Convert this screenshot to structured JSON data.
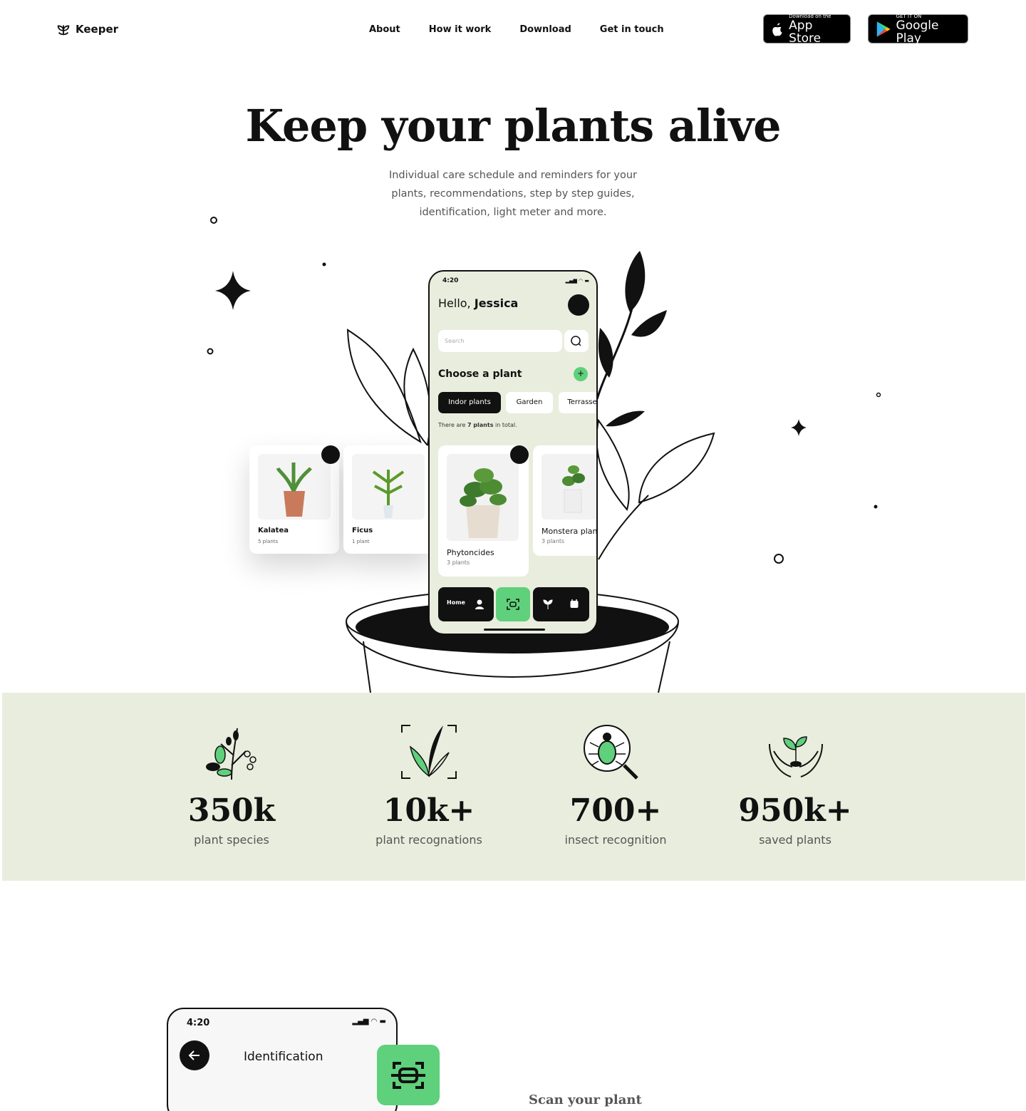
{
  "brand": {
    "name": "Keeper"
  },
  "nav": {
    "items": [
      "About",
      "How it work",
      "Download",
      "Get in touch"
    ]
  },
  "stores": {
    "appstore_small": "Download on the",
    "appstore_big": "App Store",
    "gplay_small": "GET IT ON",
    "gplay_big": "Google Play"
  },
  "hero": {
    "title": "Keep your plants alive",
    "subtitle": "Individual care schedule and reminders for your plants, recommendations, step by step guides, identification, light meter and more."
  },
  "phone": {
    "time": "4:20",
    "greeting": "Hello,",
    "user": "Jessica",
    "search_placeholder": "Search",
    "choose": "Choose a plant",
    "add_label": "+",
    "tabs": [
      "Indor plants",
      "Garden",
      "Terrasse"
    ],
    "count_prefix": "There are",
    "count_bold": "7 plants",
    "count_suffix": "in total.",
    "cards": [
      {
        "name": "Phytoncides",
        "count": "3 plants"
      },
      {
        "name": "Monstera plant",
        "count": "3 plants"
      }
    ],
    "nav_home": "Home"
  },
  "float_cards": [
    {
      "name": "Kalatea",
      "count": "5 plants"
    },
    {
      "name": "Ficus",
      "count": "1 plant"
    }
  ],
  "stats": [
    {
      "value": "350k",
      "label": "plant species",
      "icon": "plant-branch-icon"
    },
    {
      "value": "10k+",
      "label": "plant recognations",
      "icon": "scan-leaf-icon"
    },
    {
      "value": "700+",
      "label": "insect recognition",
      "icon": "bug-magnifier-icon"
    },
    {
      "value": "950k+",
      "label": "saved plants",
      "icon": "hands-sprout-icon"
    }
  ],
  "identification": {
    "time": "4:20",
    "title": "Identification",
    "scan_text": "Scan your plant"
  },
  "colors": {
    "accent": "#5fd07b",
    "panel": "#e9eddd",
    "dark": "#111111"
  }
}
